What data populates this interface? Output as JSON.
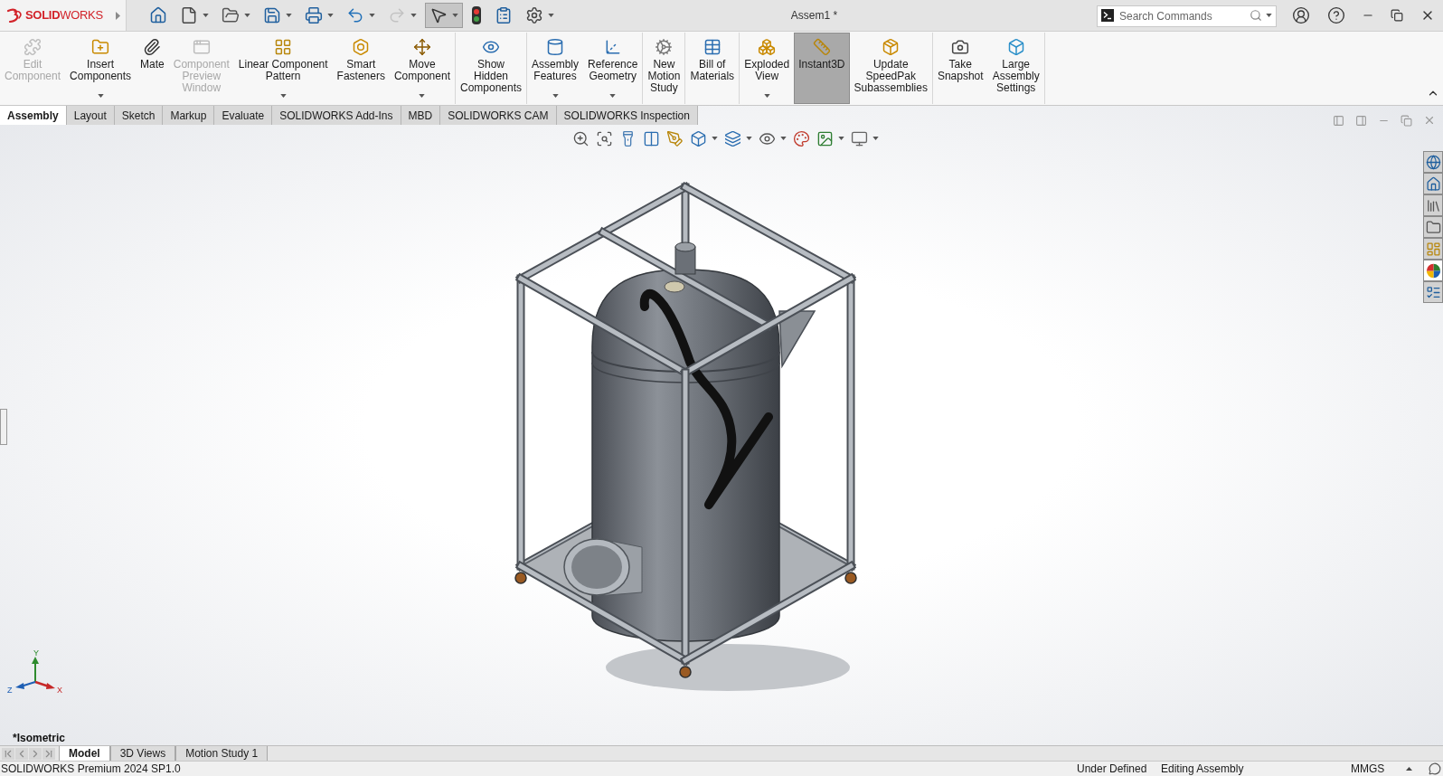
{
  "app": {
    "logo": "**SOLID**WORKS"
  },
  "quick_access_toolbar": [
    {
      "dropdown": false,
      "disabled": false,
      "selected": false
    },
    {
      "dropdown": true,
      "disabled": false,
      "selected": false
    },
    {
      "dropdown": true,
      "disabled": false,
      "selected": false
    },
    {
      "dropdown": true,
      "disabled": false,
      "selected": false
    },
    {
      "dropdown": true,
      "disabled": false,
      "selected": false
    },
    {
      "dropdown": true,
      "disabled": false,
      "selected": false
    },
    {
      "dropdown": true,
      "disabled": true,
      "selected": false
    },
    {
      "dropdown": true,
      "disabled": false,
      "selected": true
    },
    {
      "dropdown": false,
      "disabled": false,
      "selected": false
    },
    {
      "dropdown": false,
      "disabled": false,
      "selected": false
    },
    {
      "dropdown": true,
      "disabled": false,
      "selected": false
    }
  ],
  "window": {
    "title": "Assem1 *"
  },
  "search": {
    "placeholder": "Search Commands"
  },
  "ribbon": {
    "groups": [
      {
        "items": [
          {
            "label": "Edit\nComponent",
            "disabled": true,
            "selected": false,
            "dropdown": false
          },
          {
            "label": "Insert\nComponents",
            "disabled": false,
            "selected": false,
            "dropdown": true
          },
          {
            "label": "Mate",
            "disabled": false,
            "selected": false,
            "dropdown": false
          },
          {
            "label": "Component\nPreview\nWindow",
            "disabled": true,
            "selected": false,
            "dropdown": false
          },
          {
            "label": "Linear Component\nPattern",
            "disabled": false,
            "selected": false,
            "dropdown": true
          },
          {
            "label": "Smart\nFasteners",
            "disabled": false,
            "selected": false,
            "dropdown": false
          },
          {
            "label": "Move\nComponent",
            "disabled": false,
            "selected": false,
            "dropdown": true
          }
        ]
      },
      {
        "items": [
          {
            "label": "Show\nHidden\nComponents",
            "disabled": false,
            "selected": false,
            "dropdown": false
          }
        ]
      },
      {
        "items": [
          {
            "label": "Assembly\nFeatures",
            "disabled": false,
            "selected": false,
            "dropdown": true
          },
          {
            "label": "Reference\nGeometry",
            "disabled": false,
            "selected": false,
            "dropdown": true
          }
        ]
      },
      {
        "items": [
          {
            "label": "New\nMotion\nStudy",
            "disabled": false,
            "selected": false,
            "dropdown": false
          }
        ]
      },
      {
        "items": [
          {
            "label": "Bill of\nMaterials",
            "disabled": false,
            "selected": false,
            "dropdown": false
          }
        ]
      },
      {
        "items": [
          {
            "label": "Exploded\nView",
            "disabled": false,
            "selected": false,
            "dropdown": true
          },
          {
            "label": "Instant3D",
            "disabled": false,
            "selected": true,
            "dropdown": false
          },
          {
            "label": "Update\nSpeedPak\nSubassemblies",
            "disabled": false,
            "selected": false,
            "dropdown": false
          }
        ]
      },
      {
        "items": [
          {
            "label": "Take\nSnapshot",
            "disabled": false,
            "selected": false,
            "dropdown": false
          },
          {
            "label": "Large\nAssembly\nSettings",
            "disabled": false,
            "selected": false,
            "dropdown": false
          }
        ]
      }
    ]
  },
  "command_tabs": [
    {
      "label": "Assembly",
      "selected": true
    },
    {
      "label": "Layout",
      "selected": false
    },
    {
      "label": "Sketch",
      "selected": false
    },
    {
      "label": "Markup",
      "selected": false
    },
    {
      "label": "Evaluate",
      "selected": false
    },
    {
      "label": "SOLIDWORKS Add-Ins",
      "selected": false
    },
    {
      "label": "MBD",
      "selected": false
    },
    {
      "label": "SOLIDWORKS CAM",
      "selected": false
    },
    {
      "label": "SOLIDWORKS Inspection",
      "selected": false
    }
  ],
  "task_pane_tabs": [
    {
      "selected": false
    },
    {
      "selected": false
    },
    {
      "selected": false
    },
    {
      "selected": false
    },
    {
      "selected": false
    },
    {
      "selected": true
    },
    {
      "selected": false
    }
  ],
  "viewport": {
    "triad_axes": [
      "Y",
      "Z",
      "X"
    ],
    "view_name": "*Isometric"
  },
  "bottom_tabs": [
    {
      "label": "Model",
      "selected": true
    },
    {
      "label": "3D Views",
      "selected": false
    },
    {
      "label": "Motion Study 1",
      "selected": false
    }
  ],
  "status_bar": {
    "product": "SOLIDWORKS Premium 2024 SP1.0",
    "state": "Under Defined",
    "mode": "Editing Assembly",
    "units": "MMGS"
  }
}
